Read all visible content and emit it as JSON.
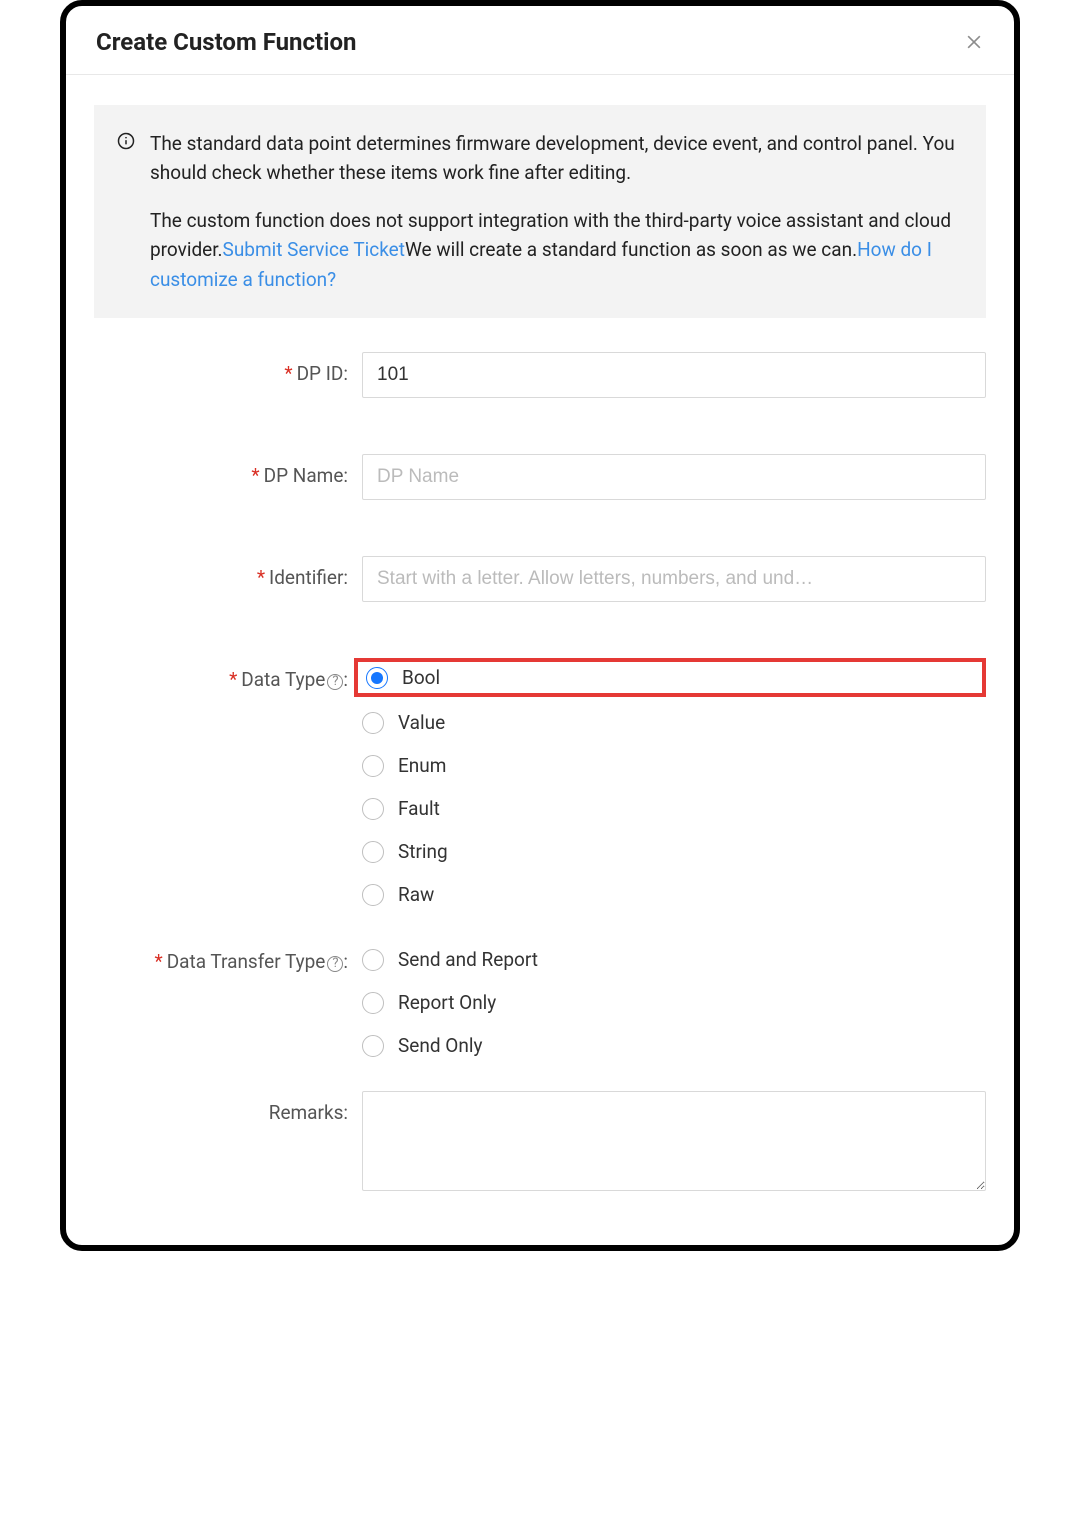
{
  "modal": {
    "title": "Create Custom Function"
  },
  "info": {
    "p1": "The standard data point determines firmware development, device event, and control panel. You should check whether these items work fine after editing.",
    "p2a": "The custom function does not support integration with the third-party voice assistant and cloud provider.",
    "link_ticket": "Submit Service Ticket",
    "p2b": "We will create a standard function as soon as we can.",
    "link_howto": "How do I customize a function?"
  },
  "form": {
    "dp_id": {
      "label": "DP ID",
      "value": "101"
    },
    "dp_name": {
      "label": "DP Name",
      "placeholder": "DP Name",
      "value": ""
    },
    "identifier": {
      "label": "Identifier",
      "placeholder": "Start with a letter. Allow letters, numbers, and und…",
      "value": ""
    },
    "data_type": {
      "label": "Data Type",
      "selected": "Bool",
      "options": [
        "Bool",
        "Value",
        "Enum",
        "Fault",
        "String",
        "Raw"
      ]
    },
    "data_transfer": {
      "label": "Data Transfer Type",
      "selected": "",
      "options": [
        "Send and Report",
        "Report Only",
        "Send Only"
      ]
    },
    "remarks": {
      "label": "Remarks",
      "value": ""
    },
    "colon": ":"
  }
}
